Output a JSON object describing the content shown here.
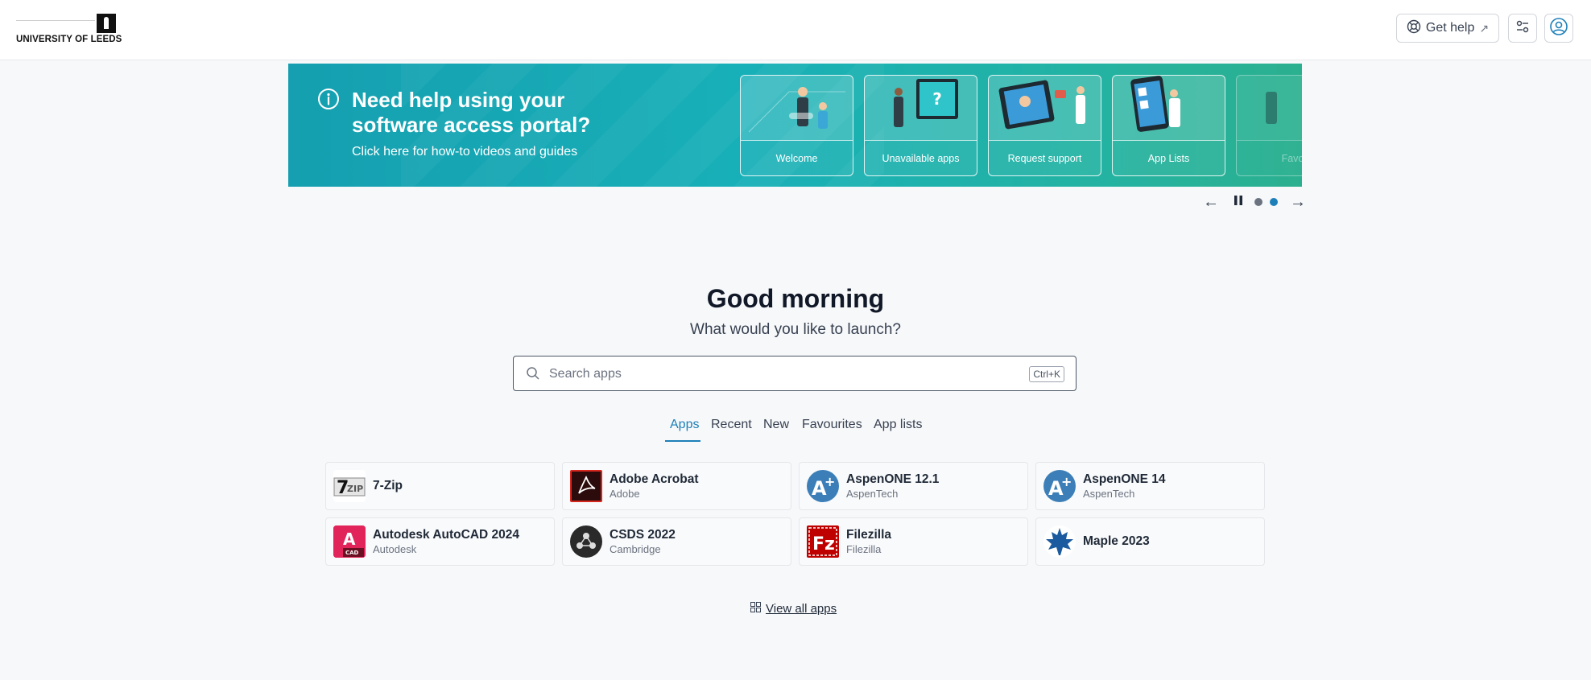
{
  "header": {
    "logo_text": "UNIVERSITY OF LEEDS",
    "get_help_label": "Get help",
    "external_glyph": "↗"
  },
  "banner": {
    "title": "Need help using your software access portal?",
    "subtitle": "Click here for how-to videos and guides",
    "cards": [
      {
        "label": "Welcome"
      },
      {
        "label": "Unavailable apps"
      },
      {
        "label": "Request support"
      },
      {
        "label": "App Lists"
      },
      {
        "label": "Favo"
      }
    ]
  },
  "carousel": {
    "prev_glyph": "←",
    "next_glyph": "→",
    "dots": 2,
    "active_dot": 2
  },
  "greeting": {
    "title": "Good morning",
    "subtitle": "What would you like to launch?"
  },
  "search": {
    "placeholder": "Search apps",
    "value": "",
    "shortcut": "Ctrl+K"
  },
  "tabs": [
    {
      "label": "Apps",
      "active": true
    },
    {
      "label": "Recent",
      "active": false
    },
    {
      "label": "New",
      "active": false
    },
    {
      "label": "Favourites",
      "active": false
    },
    {
      "label": "App lists",
      "active": false
    }
  ],
  "apps": [
    {
      "name": "7-Zip",
      "vendor": "",
      "icon": "7zip-icon"
    },
    {
      "name": "Adobe Acrobat",
      "vendor": "Adobe",
      "icon": "adobe-acrobat-icon"
    },
    {
      "name": "AspenONE 12.1",
      "vendor": "AspenTech",
      "icon": "aspentech-icon"
    },
    {
      "name": "AspenONE 14",
      "vendor": "AspenTech",
      "icon": "aspentech-icon"
    },
    {
      "name": "Autodesk AutoCAD 2024",
      "vendor": "Autodesk",
      "icon": "autocad-icon"
    },
    {
      "name": "CSDS 2022",
      "vendor": "Cambridge",
      "icon": "csds-icon"
    },
    {
      "name": "Filezilla",
      "vendor": "Filezilla",
      "icon": "filezilla-icon"
    },
    {
      "name": "Maple 2023",
      "vendor": "",
      "icon": "maple-icon"
    }
  ],
  "view_all_label": "View all apps",
  "colors": {
    "accent": "#1d7fb8",
    "banner_start": "#159fb0",
    "banner_end": "#2bb08f"
  }
}
